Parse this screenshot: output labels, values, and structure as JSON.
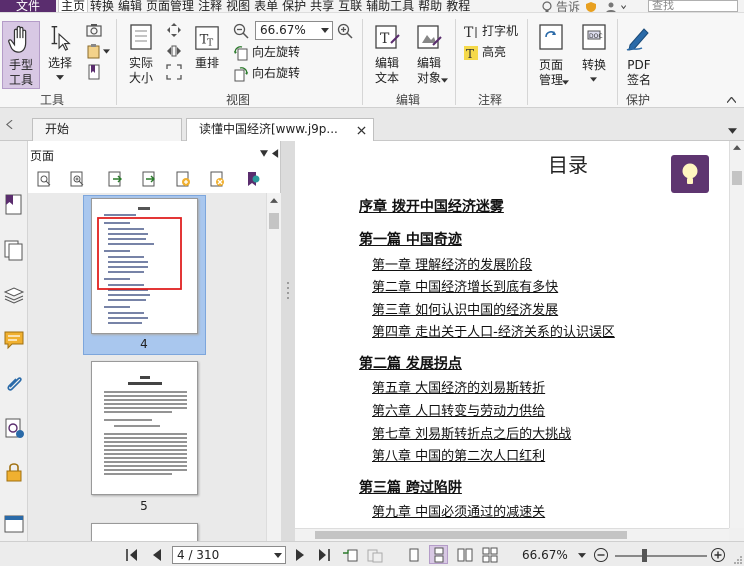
{
  "menubar": {
    "file_label": "文件",
    "items": [
      "主页",
      "转换",
      "编辑",
      "页面管理",
      "注释",
      "视图",
      "表单",
      "保护",
      "共享",
      "互联",
      "辅助工具",
      "帮助",
      "教程"
    ],
    "tell_me": "告诉",
    "search_placeholder": "查找"
  },
  "ribbon": {
    "hand": "手型\n工具",
    "select": "选择",
    "actual_size": "实际\n大小",
    "reflow": "重排",
    "zoom_value": "66.67%",
    "rotate_left": "向左旋转",
    "rotate_right": "向右旋转",
    "edit_text": "编辑\n文本",
    "edit_object": "编辑\n对象",
    "typewriter": "打字机",
    "highlight": "高亮",
    "page_manage": "页面\n管理",
    "convert": "转换",
    "pdf_sign": "PDF\n签名",
    "groups": {
      "tools": "工具",
      "view": "视图",
      "edit": "编辑",
      "comment": "注释",
      "protect": "保护"
    }
  },
  "tabs": [
    {
      "label": "开始"
    },
    {
      "label": "读懂中国经济[www.j9p..."
    }
  ],
  "panel": {
    "title": "页面",
    "thumbs": [
      {
        "num": "4"
      },
      {
        "num": "5"
      }
    ]
  },
  "document": {
    "title": "目录",
    "entries": [
      {
        "type": "part",
        "text": "序章 拨开中国经济迷雾"
      },
      {
        "type": "part",
        "text": "第一篇 中国奇迹"
      },
      {
        "type": "ch",
        "text": "第一章 理解经济的发展阶段"
      },
      {
        "type": "ch",
        "text": "第二章 中国经济增长到底有多快"
      },
      {
        "type": "ch",
        "text": "第三章 如何认识中国的经济发展"
      },
      {
        "type": "ch",
        "text": "第四章 走出关于人口-经济关系的认识误区"
      },
      {
        "type": "part",
        "text": "第二篇 发展拐点"
      },
      {
        "type": "ch",
        "text": "第五章 大国经济的刘易斯转折"
      },
      {
        "type": "ch",
        "text": "第六章 人口转变与劳动力供给"
      },
      {
        "type": "ch",
        "text": "第七章 刘易斯转折点之后的大挑战"
      },
      {
        "type": "ch",
        "text": "第八章 中国的第二次人口红利"
      },
      {
        "type": "part",
        "text": "第三篇 跨过陷阱"
      },
      {
        "type": "ch",
        "text": "第九章 中国必须通过的减速关"
      }
    ]
  },
  "status": {
    "page_value": "4 / 310",
    "zoom": "66.67%"
  },
  "colors": {
    "brand": "#5a2d6e",
    "selection": "#a9c7ee",
    "highlight_box": "#e02020"
  }
}
